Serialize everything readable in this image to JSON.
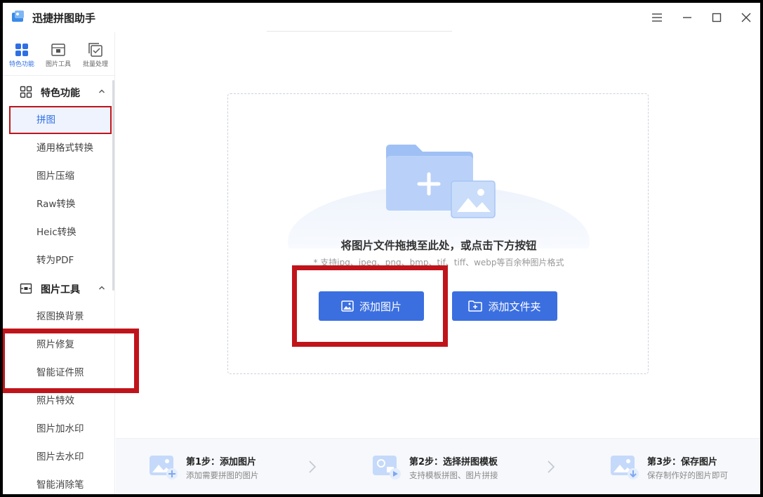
{
  "app": {
    "title": "迅捷拼图助手"
  },
  "colors": {
    "accent": "#3b6fe0",
    "annotation_red": "#c0141b",
    "active_bg": "#eef3fd"
  },
  "top_tabs": [
    {
      "label": "特色功能",
      "icon": "grid-icon"
    },
    {
      "label": "图片工具",
      "icon": "image-tools-icon"
    },
    {
      "label": "批量处理",
      "icon": "batch-icon"
    }
  ],
  "sidebar": {
    "groups": [
      {
        "label": "特色功能",
        "icon": "grid-icon",
        "items": [
          "拼图",
          "通用格式转换",
          "图片压缩",
          "Raw转换",
          "Heic转换",
          "转为PDF"
        ]
      },
      {
        "label": "图片工具",
        "icon": "image-tools-icon",
        "items": [
          "抠图换背景",
          "照片修复",
          "智能证件照",
          "照片特效",
          "图片加水印",
          "图片去水印",
          "智能消除笔"
        ]
      }
    ],
    "active_item": "拼图"
  },
  "dropzone": {
    "title": "将图片文件拖拽至此处，或点击下方按钮",
    "hint": "* 支持jpg、jpeg、png、bmp、tif、tiff、webp等百余种图片格式",
    "add_image_label": "添加图片",
    "add_folder_label": "添加文件夹"
  },
  "steps": [
    {
      "title": "第1步：添加图片",
      "desc": "添加需要拼图的图片"
    },
    {
      "title": "第2步：选择拼图模板",
      "desc": "支持模板拼图、图片拼接"
    },
    {
      "title": "第3步：保存图片",
      "desc": "保存制作好的图片即可"
    }
  ]
}
